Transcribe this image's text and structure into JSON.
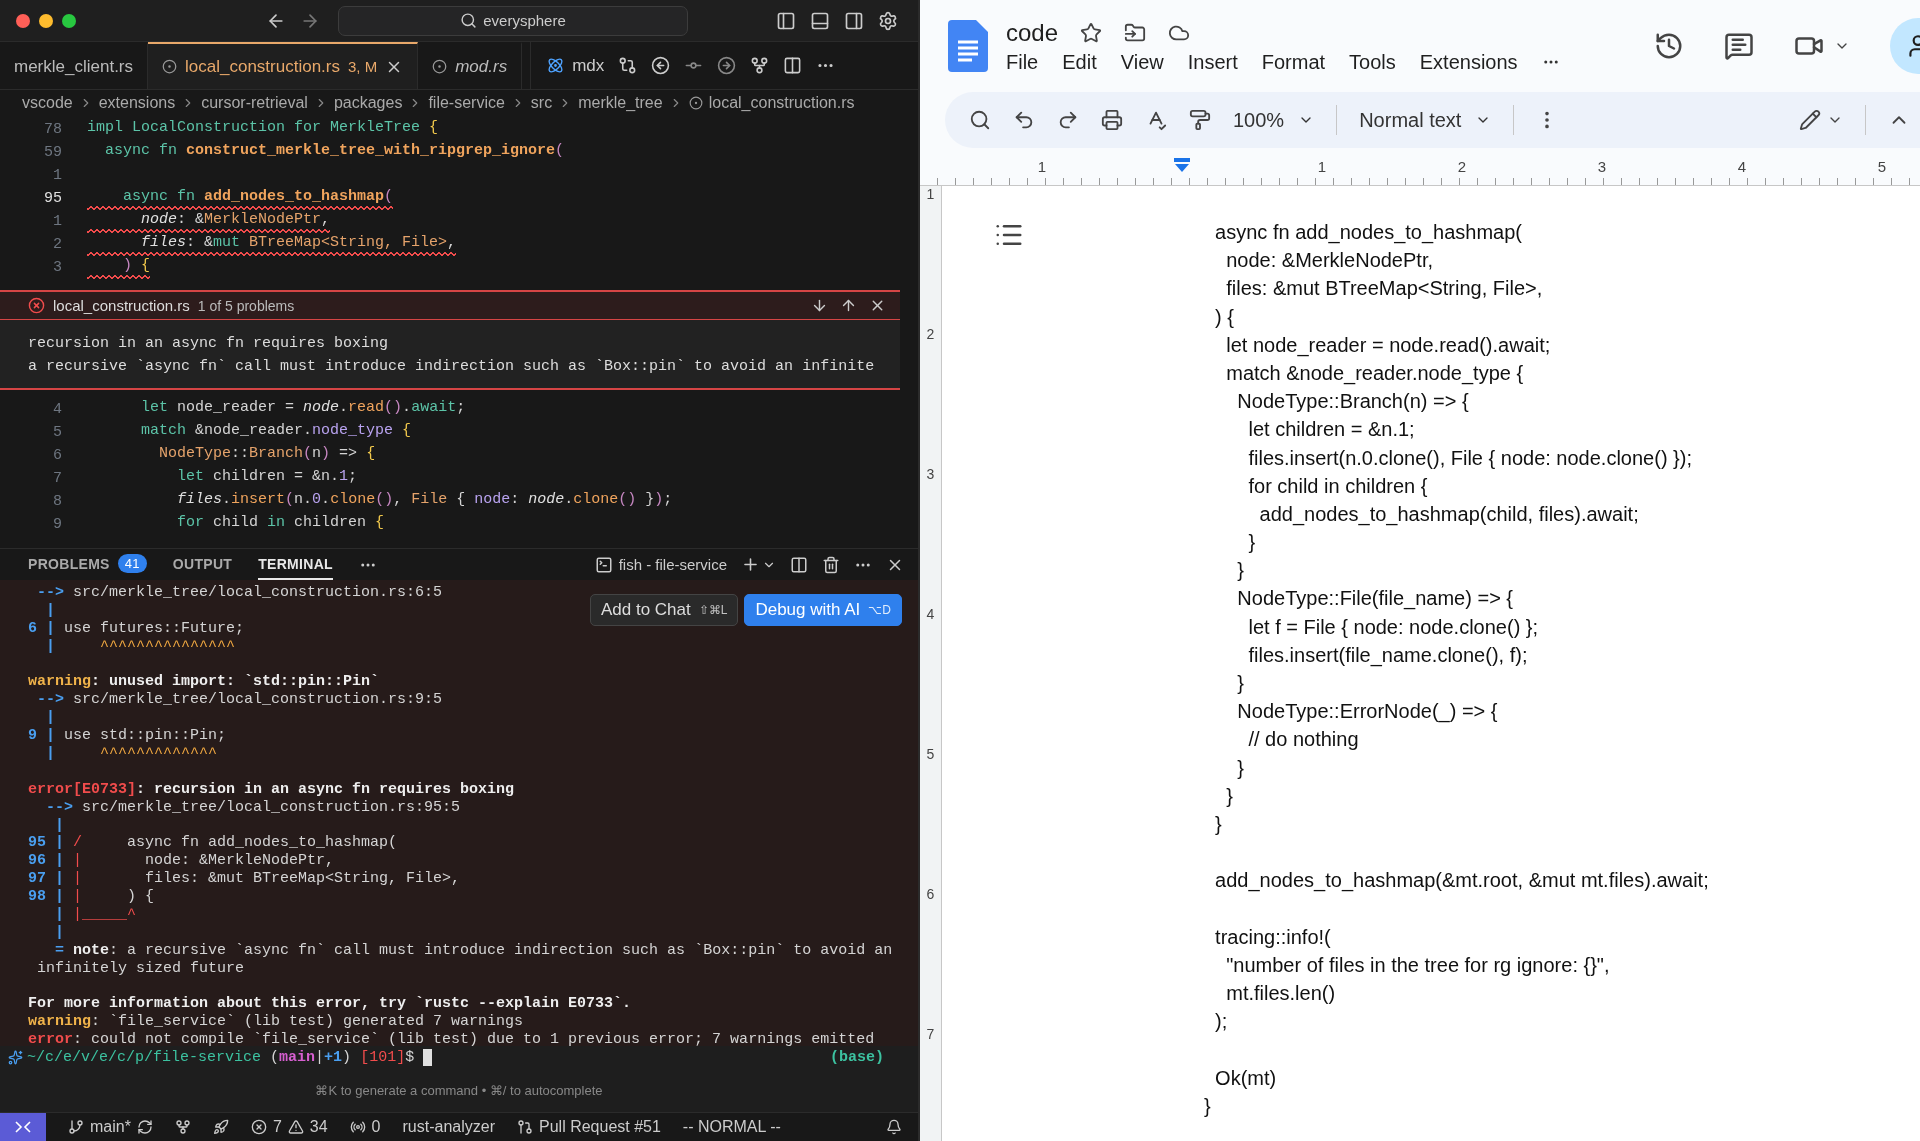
{
  "vscode": {
    "search": "everysphere",
    "tabs": [
      {
        "label": "merkle_client.rs",
        "selected": false,
        "preview": false
      },
      {
        "label": "local_construction.rs",
        "status": "3, M",
        "selected": true,
        "preview": false
      },
      {
        "label": "mod.rs",
        "selected": false,
        "preview": true
      }
    ],
    "secondary_tab": {
      "label": "mdx"
    },
    "breadcrumbs": [
      "vscode",
      "extensions",
      "cursor-retrieval",
      "packages",
      "file-service",
      "src",
      "merkle_tree",
      "local_construction.rs"
    ],
    "editor_top": [
      {
        "number": "78",
        "current": false,
        "squiggle": false,
        "segments": [
          {
            "t": "impl",
            "kind": "kw"
          },
          {
            "t": " LocalConstruction ",
            "kind": "trait"
          },
          {
            "t": "for",
            "kind": "kw"
          },
          {
            "t": " MerkleTree ",
            "kind": "trait"
          },
          {
            "t": "{",
            "kind": "brace"
          }
        ]
      },
      {
        "number": "59",
        "current": false,
        "squiggle": false,
        "segments": [
          {
            "t": "  async fn ",
            "kind": "kw"
          },
          {
            "t": "construct_merkle_tree_with_ripgrep_ignore",
            "kind": "fn"
          },
          {
            "t": "(",
            "kind": "paren"
          }
        ]
      },
      {
        "number": "1",
        "current": false
      },
      {
        "number": "95",
        "current": true,
        "squiggle": true,
        "segments": [
          {
            "t": "    async fn ",
            "kind": "kw"
          },
          {
            "t": "add_nodes_to_hashmap",
            "kind": "fn"
          },
          {
            "t": "(",
            "kind": "paren"
          }
        ]
      },
      {
        "number": "1",
        "current": false,
        "squiggle": true,
        "segments": [
          {
            "t": "      node",
            "kind": "param"
          },
          {
            "t": ": &",
            "kind": "plain"
          },
          {
            "t": "MerkleNodePtr",
            "kind": "type"
          },
          {
            "t": ",",
            "kind": "plain"
          }
        ]
      },
      {
        "number": "2",
        "current": false,
        "squiggle": true,
        "segments": [
          {
            "t": "      files",
            "kind": "param"
          },
          {
            "t": ": &",
            "kind": "plain"
          },
          {
            "t": "mut ",
            "kind": "kw"
          },
          {
            "t": "BTreeMap<String, File>",
            "kind": "type"
          },
          {
            "t": ",",
            "kind": "plain"
          }
        ]
      },
      {
        "number": "3",
        "current": false,
        "squiggle": true,
        "segments": [
          {
            "t": "    ) ",
            "kind": "paren"
          },
          {
            "t": "{",
            "kind": "brace"
          }
        ]
      }
    ],
    "peek": {
      "file": "local_construction.rs",
      "count": "1 of 5 problems",
      "messages": [
        "recursion in an async fn requires boxing",
        "a recursive `async fn` call must introduce indirection such as `Box::pin` to avoid an infinite"
      ]
    },
    "editor_bottom": [
      {
        "number": "4",
        "current": false,
        "squiggle": false,
        "segments": [
          {
            "t": "      let ",
            "kind": "kw"
          },
          {
            "t": "node_reader = ",
            "kind": "plain"
          },
          {
            "t": "node",
            "kind": "param"
          },
          {
            "t": ".",
            "kind": "plain"
          },
          {
            "t": "read",
            "kind": "method"
          },
          {
            "t": "()",
            "kind": "paren"
          },
          {
            "t": ".",
            "kind": "plain"
          },
          {
            "t": "await",
            "kind": "kw"
          },
          {
            "t": ";",
            "kind": "plain"
          }
        ]
      },
      {
        "number": "5",
        "current": false,
        "squiggle": false,
        "segments": [
          {
            "t": "      match ",
            "kind": "kw"
          },
          {
            "t": "&node_reader.",
            "kind": "plain"
          },
          {
            "t": "node_type ",
            "kind": "field"
          },
          {
            "t": "{",
            "kind": "brace"
          }
        ]
      },
      {
        "number": "6",
        "current": false,
        "squiggle": false,
        "segments": [
          {
            "t": "        NodeType",
            "kind": "type"
          },
          {
            "t": "::",
            "kind": "plain"
          },
          {
            "t": "Branch",
            "kind": "type"
          },
          {
            "t": "(",
            "kind": "paren"
          },
          {
            "t": "n",
            "kind": "plain"
          },
          {
            "t": ")",
            "kind": "paren"
          },
          {
            "t": " => ",
            "kind": "plain"
          },
          {
            "t": "{",
            "kind": "brace"
          }
        ]
      },
      {
        "number": "7",
        "current": false,
        "squiggle": false,
        "segments": [
          {
            "t": "          let ",
            "kind": "kw"
          },
          {
            "t": "children = &n.",
            "kind": "plain"
          },
          {
            "t": "1",
            "kind": "num"
          },
          {
            "t": ";",
            "kind": "plain"
          }
        ]
      },
      {
        "number": "8",
        "current": false,
        "squiggle": false,
        "segments": [
          {
            "t": "          files",
            "kind": "param"
          },
          {
            "t": ".",
            "kind": "plain"
          },
          {
            "t": "insert",
            "kind": "method"
          },
          {
            "t": "(",
            "kind": "paren"
          },
          {
            "t": "n.",
            "kind": "plain"
          },
          {
            "t": "0",
            "kind": "num"
          },
          {
            "t": ".",
            "kind": "plain"
          },
          {
            "t": "clone",
            "kind": "method"
          },
          {
            "t": "()",
            "kind": "paren"
          },
          {
            "t": ", ",
            "kind": "plain"
          },
          {
            "t": "File",
            "kind": "type"
          },
          {
            "t": " { ",
            "kind": "plain"
          },
          {
            "t": "node",
            "kind": "field"
          },
          {
            "t": ": ",
            "kind": "plain"
          },
          {
            "t": "node",
            "kind": "param"
          },
          {
            "t": ".",
            "kind": "plain"
          },
          {
            "t": "clone",
            "kind": "method"
          },
          {
            "t": "()",
            "kind": "paren"
          },
          {
            "t": " }",
            "kind": "plain"
          },
          {
            "t": ")",
            "kind": "paren"
          },
          {
            "t": ";",
            "kind": "plain"
          }
        ]
      },
      {
        "number": "9",
        "current": false,
        "squiggle": false,
        "segments": [
          {
            "t": "          for ",
            "kind": "kw"
          },
          {
            "t": "child ",
            "kind": "plain"
          },
          {
            "t": "in ",
            "kind": "kw"
          },
          {
            "t": "children ",
            "kind": "plain"
          },
          {
            "t": "{",
            "kind": "brace"
          }
        ]
      }
    ],
    "panel_tabs": [
      {
        "label": "PROBLEMS",
        "badge": "41",
        "selected": false
      },
      {
        "label": "OUTPUT",
        "selected": false
      },
      {
        "label": "TERMINAL",
        "selected": true
      }
    ],
    "terminal_title": "fish - file-service",
    "terminal_actions": [
      {
        "label": "Add to Chat",
        "shortcut": "⇧⌘L",
        "primary": false
      },
      {
        "label": "Debug with AI",
        "shortcut": "⌥D",
        "primary": true
      }
    ],
    "terminal_lines": [
      {
        "kind": "text",
        "segments": [
          {
            "t": " -->",
            "kind": "gutter"
          },
          {
            "t": " src/merkle_tree/local_construction.rs:6:5",
            "kind": "plain"
          }
        ]
      },
      {
        "kind": "text",
        "segments": [
          {
            "t": "  |",
            "kind": "gutter"
          }
        ]
      },
      {
        "kind": "text",
        "segments": [
          {
            "t": "6 |",
            "kind": "gutter"
          },
          {
            "t": " use futures::Future;",
            "kind": "plain"
          }
        ]
      },
      {
        "kind": "text",
        "segments": [
          {
            "t": "  |",
            "kind": "gutter"
          },
          {
            "t": "     ^^^^^^^^^^^^^^^",
            "kind": "caret"
          }
        ]
      },
      {
        "kind": "blank"
      },
      {
        "kind": "text",
        "segments": [
          {
            "t": "warning",
            "kind": "warning"
          },
          {
            "t": ": unused import: `std::pin::Pin`",
            "kind": "bold"
          }
        ]
      },
      {
        "kind": "text",
        "segments": [
          {
            "t": " -->",
            "kind": "gutter"
          },
          {
            "t": " src/merkle_tree/local_construction.rs:9:5",
            "kind": "plain"
          }
        ]
      },
      {
        "kind": "text",
        "segments": [
          {
            "t": "  |",
            "kind": "gutter"
          }
        ]
      },
      {
        "kind": "text",
        "segments": [
          {
            "t": "9 |",
            "kind": "gutter"
          },
          {
            "t": " use std::pin::Pin;",
            "kind": "plain"
          }
        ]
      },
      {
        "kind": "text",
        "segments": [
          {
            "t": "  |",
            "kind": "gutter"
          },
          {
            "t": "     ^^^^^^^^^^^^^",
            "kind": "caret"
          }
        ]
      },
      {
        "kind": "blank"
      },
      {
        "kind": "text",
        "segments": [
          {
            "t": "error[E0733]",
            "kind": "error"
          },
          {
            "t": ": recursion in an async fn requires boxing",
            "kind": "bold"
          }
        ]
      },
      {
        "kind": "text",
        "segments": [
          {
            "t": "  -->",
            "kind": "gutter"
          },
          {
            "t": " src/merkle_tree/local_construction.rs:95:5",
            "kind": "plain"
          }
        ]
      },
      {
        "kind": "text",
        "segments": [
          {
            "t": "   |",
            "kind": "gutter"
          }
        ]
      },
      {
        "kind": "text",
        "segments": [
          {
            "t": "95 |",
            "kind": "gutter"
          },
          {
            "t": " /",
            "kind": "red"
          },
          {
            "t": "     async fn add_nodes_to_hashmap(",
            "kind": "plain"
          }
        ]
      },
      {
        "kind": "text",
        "segments": [
          {
            "t": "96 |",
            "kind": "gutter"
          },
          {
            "t": " |",
            "kind": "red"
          },
          {
            "t": "       node: &MerkleNodePtr,",
            "kind": "plain"
          }
        ]
      },
      {
        "kind": "text",
        "segments": [
          {
            "t": "97 |",
            "kind": "gutter"
          },
          {
            "t": " |",
            "kind": "red"
          },
          {
            "t": "       files: &mut BTreeMap<String, File>,",
            "kind": "plain"
          }
        ]
      },
      {
        "kind": "text",
        "segments": [
          {
            "t": "98 |",
            "kind": "gutter"
          },
          {
            "t": " |",
            "kind": "red"
          },
          {
            "t": "     ) {",
            "kind": "plain"
          }
        ]
      },
      {
        "kind": "text",
        "segments": [
          {
            "t": "   |",
            "kind": "gutter"
          },
          {
            "t": " |_____^",
            "kind": "red"
          }
        ]
      },
      {
        "kind": "text",
        "segments": [
          {
            "t": "   |",
            "kind": "gutter"
          }
        ]
      },
      {
        "kind": "text",
        "segments": [
          {
            "t": "   =",
            "kind": "gutter"
          },
          {
            "t": " note",
            "kind": "bold"
          },
          {
            "t": ": a recursive `async fn` call must introduce indirection such as `Box::pin` to avoid an",
            "kind": "plain"
          }
        ]
      },
      {
        "kind": "text",
        "segments": [
          {
            "t": " infinitely sized future",
            "kind": "plain"
          }
        ]
      },
      {
        "kind": "blank"
      },
      {
        "kind": "text",
        "segments": [
          {
            "t": "For more information about this error, try `rustc --explain E0733`.",
            "kind": "bold"
          }
        ]
      },
      {
        "kind": "text",
        "segments": [
          {
            "t": "warning",
            "kind": "warning"
          },
          {
            "t": ": `file_service` (lib test) generated 7 warnings",
            "kind": "plain"
          }
        ]
      },
      {
        "kind": "text",
        "segments": [
          {
            "t": "error",
            "kind": "error"
          },
          {
            "t": ": could not compile `file_service` (lib test) due to 1 previous error; 7 warnings emitted",
            "kind": "plain"
          }
        ]
      }
    ],
    "prompt": {
      "segments": [
        {
          "t": "~/c/e/v/e/c/p/file-service",
          "kind": "path"
        },
        {
          "t": " (",
          "kind": "plain"
        },
        {
          "t": "main",
          "kind": "branch"
        },
        {
          "t": "|",
          "kind": "plain"
        },
        {
          "t": "+1",
          "kind": "gutter"
        },
        {
          "t": ")",
          "kind": "plain"
        },
        {
          "t": " [101]",
          "kind": "red"
        },
        {
          "t": "$",
          "kind": "plain"
        }
      ],
      "env": "(base)"
    },
    "terminal_hint": "⌘K to generate a command • ⌘/ to autocomplete",
    "status_bar": {
      "branch": "main*",
      "errors": "7",
      "warnings": "34",
      "ports": "0",
      "language_server": "rust-analyzer",
      "pull_request": "Pull Request #51",
      "mode": "-- NORMAL --"
    }
  },
  "docs": {
    "title": "code",
    "menu": [
      "File",
      "Edit",
      "View",
      "Insert",
      "Format",
      "Tools",
      "Extensions"
    ],
    "toolbar": {
      "zoom": "100%",
      "style": "Normal text"
    },
    "ruler": [
      "1",
      "1",
      "2",
      "3",
      "4",
      "5"
    ],
    "vertical_ruler": [
      "1",
      "2",
      "3",
      "4",
      "5",
      "6",
      "7"
    ],
    "lines": [
      {
        "kind": "text",
        "text": "  async fn add_nodes_to_hashmap("
      },
      {
        "kind": "text",
        "text": "    node: &MerkleNodePtr,"
      },
      {
        "kind": "text",
        "text": "    files: &mut BTreeMap<String, File>,"
      },
      {
        "kind": "text",
        "text": "  ) {"
      },
      {
        "kind": "text",
        "text": "    let node_reader = node.read().await;"
      },
      {
        "kind": "text",
        "text": "    match &node_reader.node_type {"
      },
      {
        "kind": "text",
        "text": "      NodeType::Branch(n) => {"
      },
      {
        "kind": "text",
        "text": "        let children = &n.1;"
      },
      {
        "kind": "text",
        "text": "        files.insert(n.0.clone(), File { node: node.clone() });"
      },
      {
        "kind": "text",
        "text": "        for child in children {"
      },
      {
        "kind": "text",
        "text": "          add_nodes_to_hashmap(child, files).await;"
      },
      {
        "kind": "text",
        "text": "        }"
      },
      {
        "kind": "text",
        "text": "      }"
      },
      {
        "kind": "text",
        "text": "      NodeType::File(file_name) => {"
      },
      {
        "kind": "text",
        "text": "        let f = File { node: node.clone() };"
      },
      {
        "kind": "text",
        "text": "        files.insert(file_name.clone(), f);"
      },
      {
        "kind": "text",
        "text": "      }"
      },
      {
        "kind": "text",
        "text": "      NodeType::ErrorNode(_) => {"
      },
      {
        "kind": "text",
        "text": "        // do nothing"
      },
      {
        "kind": "text",
        "text": "      }"
      },
      {
        "kind": "text",
        "text": "    }"
      },
      {
        "kind": "text",
        "text": "  }"
      },
      {
        "kind": "blank"
      },
      {
        "kind": "text",
        "text": "  add_nodes_to_hashmap(&mt.root, &mut mt.files).await;"
      },
      {
        "kind": "blank"
      },
      {
        "kind": "text",
        "text": "  tracing::info!("
      },
      {
        "kind": "text",
        "text": "    \"number of files in the tree for rg ignore: {}\","
      },
      {
        "kind": "text",
        "text": "    mt.files.len()"
      },
      {
        "kind": "text",
        "text": "  );"
      },
      {
        "kind": "blank"
      },
      {
        "kind": "text",
        "text": "  Ok(mt)"
      },
      {
        "kind": "text",
        "text": "}"
      }
    ]
  }
}
